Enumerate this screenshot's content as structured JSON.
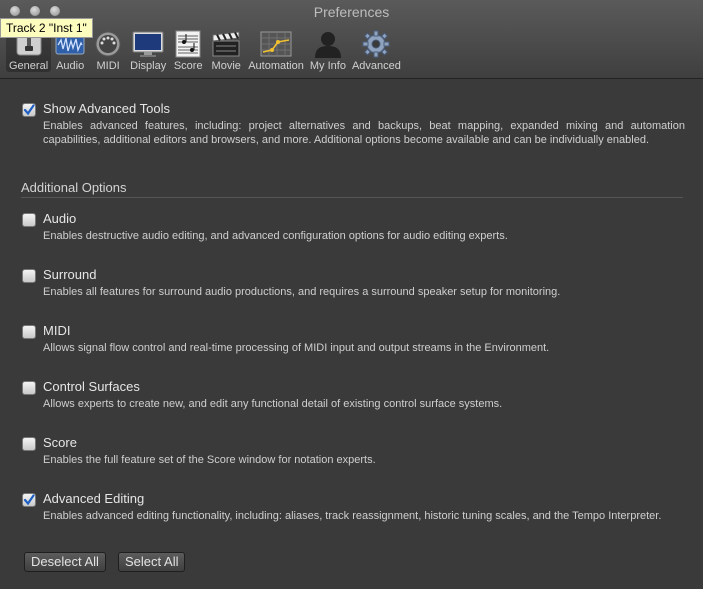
{
  "window": {
    "title": "Preferences",
    "tooltip": "Track 2 \"Inst 1\""
  },
  "toolbar": {
    "items": [
      {
        "label": "General",
        "icon": "general-icon"
      },
      {
        "label": "Audio",
        "icon": "audio-waveform-icon"
      },
      {
        "label": "MIDI",
        "icon": "midi-connector-icon"
      },
      {
        "label": "Display",
        "icon": "display-monitor-icon"
      },
      {
        "label": "Score",
        "icon": "score-sheet-icon"
      },
      {
        "label": "Movie",
        "icon": "clapperboard-icon"
      },
      {
        "label": "Automation",
        "icon": "automation-icon"
      },
      {
        "label": "My Info",
        "icon": "person-silhouette-icon"
      },
      {
        "label": "Advanced",
        "icon": "gear-icon"
      }
    ],
    "active": "General"
  },
  "advanced_tools": {
    "label": "Show Advanced Tools",
    "checked": true,
    "description": "Enables advanced features, including: project alternatives and backups, beat mapping, expanded mixing and automation capabilities, additional editors and browsers, and more. Additional options become available and can be individually enabled."
  },
  "additional_options": {
    "heading": "Additional Options",
    "options": [
      {
        "label": "Audio",
        "checked": false,
        "description": "Enables destructive audio editing, and advanced configuration options for audio editing experts."
      },
      {
        "label": "Surround",
        "checked": false,
        "description": "Enables all features for surround audio productions, and requires a surround speaker setup for monitoring."
      },
      {
        "label": "MIDI",
        "checked": false,
        "description": "Allows signal flow control and real-time processing of MIDI input and output streams in the Environment."
      },
      {
        "label": "Control Surfaces",
        "checked": false,
        "description": "Allows experts to create new, and edit any functional detail of existing control surface systems."
      },
      {
        "label": "Score",
        "checked": false,
        "description": "Enables the full feature set of the Score window for notation experts."
      },
      {
        "label": "Advanced Editing",
        "checked": true,
        "description": "Enables advanced editing functionality, including: aliases, track reassignment, historic tuning scales, and the Tempo Interpreter."
      }
    ]
  },
  "buttons": {
    "deselect_all": "Deselect All",
    "select_all": "Select All"
  },
  "colors": {
    "checkbox_check": "#1e5fc4",
    "background": "#3a3a3a"
  }
}
